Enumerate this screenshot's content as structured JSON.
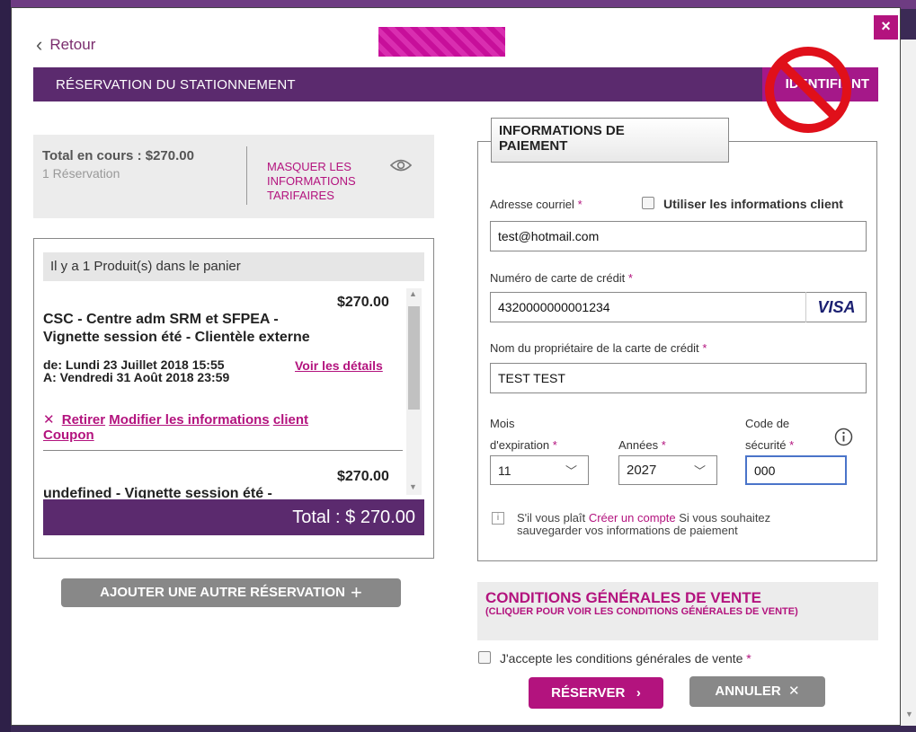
{
  "colors": {
    "brand_purple": "#5b2a6e",
    "accent_magenta": "#b3137e",
    "ident_tab": "#a51889"
  },
  "nav": {
    "back_label": "Retour",
    "close_label": "×"
  },
  "header": {
    "title": "RÉSERVATION DU STATIONNEMENT",
    "ident_label": "IDENTIFIANT"
  },
  "summary": {
    "total": "Total en cours : $270.00",
    "count": "1 Réservation",
    "mask_line1": "MASQUER LES",
    "mask_line2": "INFORMATIONS",
    "mask_line3": "TARIFAIRES"
  },
  "cart": {
    "header": "Il y a 1 Produit(s) dans le panier",
    "items": [
      {
        "price": "$270.00",
        "title_line1": "CSC - Centre adm SRM et SFPEA -",
        "title_line2": "Vignette session été - Clientèle externe",
        "from": "de: Lundi 23 Juillet 2018 15:55",
        "to": "A: Vendredi 31 Août 2018 23:59",
        "details_link": "Voir les détails",
        "remove": "Retirer",
        "modify": "Modifier les informations",
        "client": "client",
        "coupon": "Coupon"
      },
      {
        "price": "$270.00",
        "title": "undefined - Vignette session été -"
      }
    ],
    "total": "Total : $ 270.00",
    "add_button": "AJOUTER UNE AUTRE RÉSERVATION"
  },
  "payment": {
    "tab_line1": "INFORMATIONS DE",
    "tab_line2": "PAIEMENT",
    "email_label": "Adresse courriel",
    "use_client_label": "Utiliser les informations client",
    "email_value": "test@hotmail.com",
    "card_label": "Numéro de carte de crédit",
    "card_value": "4320000000001234",
    "card_brand": "VISA",
    "owner_label": "Nom du propriétaire de la carte de crédit",
    "owner_value": "TEST TEST",
    "month_label_1": "Mois",
    "month_label_2": "d'expiration",
    "year_label": "Années",
    "cvv_label_1": "Code de",
    "cvv_label_2": "sécurité",
    "required_mark": "*",
    "month_value": "11",
    "year_value": "2027",
    "cvv_value": "000",
    "note_before": "S'il vous plaît",
    "note_link": "Créer un compte",
    "note_after_1": "Si vous souhaitez",
    "note_after_2": "sauvegarder vos informations de paiement"
  },
  "terms": {
    "title": "CONDITIONS GÉNÉRALES DE VENTE",
    "subtitle": "(CLIQUER POUR VOIR LES CONDITIONS GÉNÉRALES DE VENTE)",
    "accept_label": "J'accepte les conditions générales de vente"
  },
  "actions": {
    "reserve": "RÉSERVER",
    "cancel": "ANNULER"
  }
}
